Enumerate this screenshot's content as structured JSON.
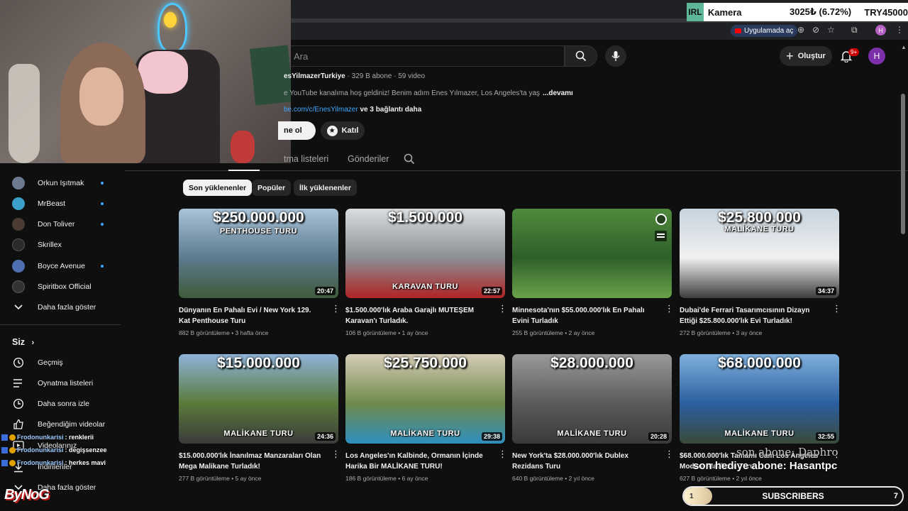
{
  "ticker": {
    "logo": "IRL",
    "name": "Kamera",
    "value": "3025₺ (6.72%)",
    "total": "TRY45000"
  },
  "browser": {
    "extension_label": "Uygulamada aç",
    "profile_initial": "H"
  },
  "header": {
    "search_placeholder": "Ara",
    "create_label": "Oluştur",
    "notification_badge": "9+",
    "avatar_initial": "H"
  },
  "channel": {
    "handle": "@EnesYilmazerTurkiye",
    "handle_visible": "esYilmazerTurkiye",
    "meta": "· 329 B abone · 59 video",
    "description": "e YouTube kanalıma hoş geldiniz! Benim adım Enes Yılmazer, Los Angeles'ta yaş",
    "more_label": "...devamı",
    "link_url": "be.com/c/EnesYilmazer",
    "link_more": "ve 3 bağlantı daha",
    "subscribe_label": "ne ol",
    "join_label": "Katıl"
  },
  "tabs": [
    {
      "label": "tma listeleri"
    },
    {
      "label": "Gönderiler"
    }
  ],
  "filters": [
    {
      "label": "Son yüklenenler",
      "active": true
    },
    {
      "label": "Popüler",
      "active": false
    },
    {
      "label": "İlk yüklenenler",
      "active": false
    }
  ],
  "sidebar": {
    "subscriptions": [
      {
        "name": "Orkun Işıtmak",
        "color": "#6b7a8f",
        "live_dot": true
      },
      {
        "name": "MrBeast",
        "color": "#3aa0c9",
        "live_dot": true
      },
      {
        "name": "Don Toliver",
        "color": "#4a3b33",
        "live_dot": true
      },
      {
        "name": "Skrillex",
        "color": "#2b2b2b",
        "live_dot": false
      },
      {
        "name": "Boyce Avenue",
        "color": "#4f6fb0",
        "live_dot": true
      },
      {
        "name": "Spiritbox Official",
        "color": "#333333",
        "live_dot": false
      }
    ],
    "show_more": "Daha fazla göster",
    "you_heading": "Siz",
    "you_items": [
      {
        "label": "Geçmiş",
        "icon": "history-icon"
      },
      {
        "label": "Oynatma listeleri",
        "icon": "playlists-icon"
      },
      {
        "label": "Daha sonra izle",
        "icon": "watch-later-icon"
      },
      {
        "label": "Beğendiğim videolar",
        "icon": "like-icon"
      },
      {
        "label": "Videolarınız",
        "icon": "your-videos-icon"
      },
      {
        "label": "İndirilenler",
        "icon": "downloads-icon"
      },
      {
        "label": "Daha fazla göster",
        "icon": "chevron-down-icon"
      }
    ]
  },
  "chat": [
    {
      "user": "Frodonunkarisi",
      "message": ": renklerii"
    },
    {
      "user": "Frodonunkarisi",
      "message": ": degişsenzee"
    },
    {
      "user": "Frodonunkarisi",
      "message": ": herkes mavi"
    }
  ],
  "streamer_logo": "ByNoG",
  "videos": [
    {
      "price": "$250.000.000",
      "subtitle": "PENTHOUSE TURU",
      "duration": "20:47",
      "title": "Dünyanın En Pahalı Evi / New York 129. Kat Penthouse Turu",
      "meta": "882 B görüntüleme • 3 hafta önce",
      "colors": [
        "#a9c3d8",
        "#5d7a8f",
        "#3f5a3a"
      ]
    },
    {
      "price": "$1.500.000",
      "subtitle": "KARAVAN TURU",
      "duration": "22:57",
      "title": "$1.500.000'lık Araba Garajlı MUTEŞEM Karavan'ı Turladık.",
      "meta": "106 B görüntüleme • 1 ay önce",
      "colors": [
        "#d9dde0",
        "#8a8f94",
        "#b02424"
      ]
    },
    {
      "price": "",
      "subtitle": "",
      "duration": "",
      "title": "Minnesota'nın $55.000.000'lık En Pahalı Evini Turladık",
      "meta": "255 B görüntüleme • 2 ay önce",
      "colors": [
        "#4f8a3c",
        "#2e5f2a",
        "#6aa24a"
      ]
    },
    {
      "price": "$25.800.000",
      "subtitle": "MALİKANE TURU",
      "duration": "34:37",
      "title": "Dubai'de Ferrari Tasarımcısının Dizayn Ettiği $25.800.000'lık Evi Turladık!",
      "meta": "272 B görüntüleme • 3 ay önce",
      "colors": [
        "#c7d4de",
        "#f0f0f0",
        "#3d3d3d"
      ]
    },
    {
      "price": "$15.000.000",
      "subtitle": "MALİKANE TURU",
      "duration": "24:36",
      "title": "$15.000.000'lık İnanılmaz Manzaraları Olan Mega Malikane Turladık!",
      "meta": "277 B görüntüleme • 5 ay önce",
      "colors": [
        "#8fb3d9",
        "#5a7a3a",
        "#3b3b3b"
      ]
    },
    {
      "price": "$25.750.000",
      "subtitle": "MALİKANE TURU",
      "duration": "29:38",
      "title": "Los Angeles'ın Kalbinde, Ormanın İçinde Harika Bir MALİKANE TURU!",
      "meta": "186 B görüntüleme • 6 ay önce",
      "colors": [
        "#d6cdb8",
        "#6f8a4a",
        "#2f8fbf"
      ]
    },
    {
      "price": "$28.000.000",
      "subtitle": "MALİKANE TURU",
      "duration": "20:28",
      "title": "New York'ta $28.000.000'lık Dublex Rezidans Turu",
      "meta": "640 B görüntüleme • 2 yıl önce",
      "colors": [
        "#9a9a9a",
        "#5a5a5a",
        "#3a3a3a"
      ]
    },
    {
      "price": "$68.000.000",
      "subtitle": "MALİKANE TURU",
      "duration": "32:55",
      "title": "$68.000.000'lık Tamamı Cam Los Angeles Modern Malikane Turu",
      "meta": "627 B görüntüleme • 2 yıl önce",
      "colors": [
        "#7fb0dc",
        "#2b5fa0",
        "#3a4a3a"
      ]
    }
  ],
  "overlays": {
    "last_sub": "son abone: Daphro",
    "last_gift": "son hediye abone: Hasantpc",
    "sub_goal": {
      "label": "SUBSCRIBERS",
      "start": "1",
      "end": "7",
      "progress": 0.13
    }
  },
  "theme": {
    "background": "#0f0f0f",
    "accent": "#3ea6ff",
    "brand_red": "#ff0000"
  }
}
